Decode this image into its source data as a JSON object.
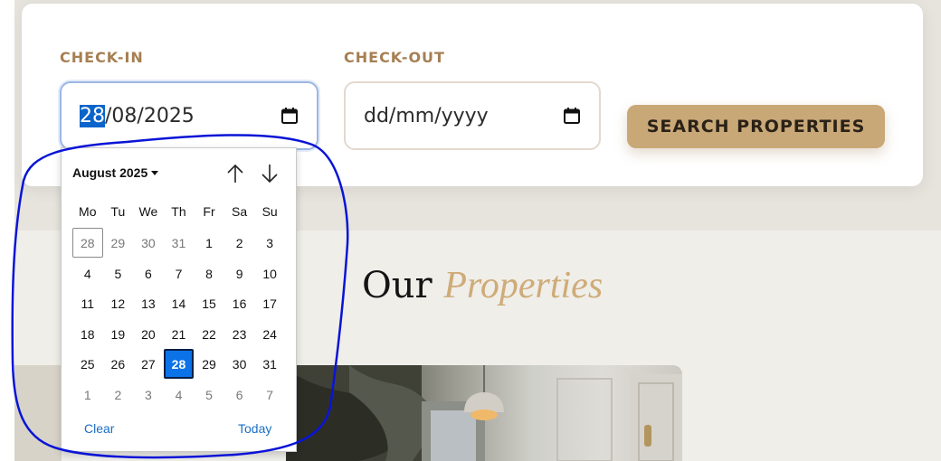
{
  "booking": {
    "checkin_label": "CHECK-IN",
    "checkin_day_selected": "28",
    "checkin_rest": "/08/2025",
    "checkout_label": "CHECK-OUT",
    "checkout_placeholder": "dd/mm/yyyy",
    "search_label": "SEARCH PROPERTIES"
  },
  "section": {
    "title_main": "Our",
    "title_accent": "Properties"
  },
  "datepicker": {
    "month_label": "August 2025",
    "weekdays": [
      "Mo",
      "Tu",
      "We",
      "Th",
      "Fr",
      "Sa",
      "Su"
    ],
    "weeks": [
      [
        "28",
        "29",
        "30",
        "31",
        "1",
        "2",
        "3"
      ],
      [
        "4",
        "5",
        "6",
        "7",
        "8",
        "9",
        "10"
      ],
      [
        "11",
        "12",
        "13",
        "14",
        "15",
        "16",
        "17"
      ],
      [
        "18",
        "19",
        "20",
        "21",
        "22",
        "23",
        "24"
      ],
      [
        "25",
        "26",
        "27",
        "28",
        "29",
        "30",
        "31"
      ],
      [
        "1",
        "2",
        "3",
        "4",
        "5",
        "6",
        "7"
      ]
    ],
    "clear_label": "Clear",
    "today_label": "Today"
  },
  "colors": {
    "accent_gold": "#c9a877",
    "label_brown": "#a67f52",
    "selected_blue": "#0b72e8",
    "annotation_blue": "#0a14d6"
  },
  "icons": {
    "calendar": "calendar-icon",
    "up": "arrow-up-icon",
    "down": "arrow-down-icon",
    "dropdown": "caret-down-icon"
  }
}
